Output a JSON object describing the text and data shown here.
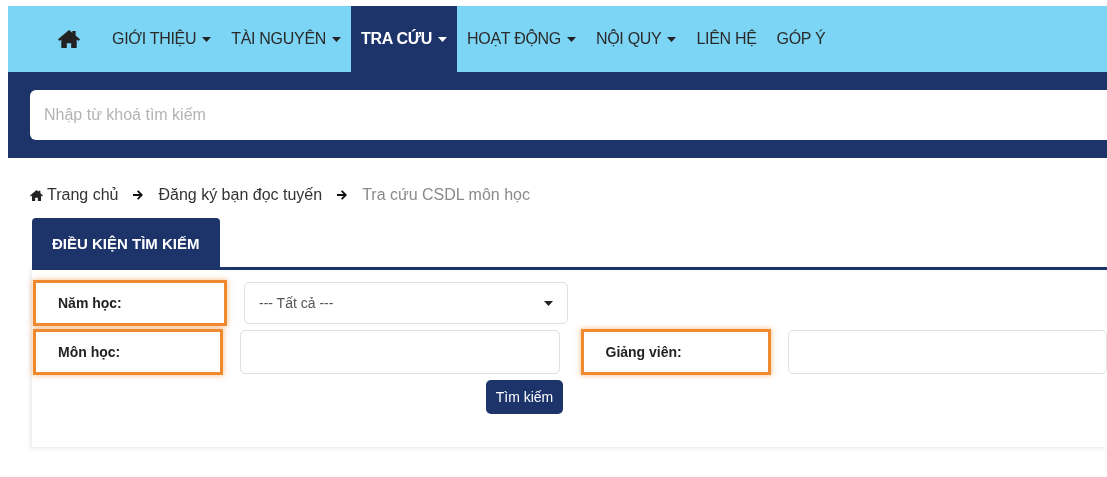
{
  "nav": {
    "items": [
      {
        "label": "GIỚI THIỆU",
        "dropdown": true,
        "selected": false
      },
      {
        "label": "TÀI NGUYÊN",
        "dropdown": true,
        "selected": false
      },
      {
        "label": "TRA CỨU",
        "dropdown": true,
        "selected": true
      },
      {
        "label": "HOẠT ĐỘNG",
        "dropdown": true,
        "selected": false
      },
      {
        "label": "NỘI QUY",
        "dropdown": true,
        "selected": false
      },
      {
        "label": "LIÊN HỆ",
        "dropdown": false,
        "selected": false
      },
      {
        "label": "GÓP Ý",
        "dropdown": false,
        "selected": false
      }
    ]
  },
  "search": {
    "placeholder": "Nhập từ khoá tìm kiếm"
  },
  "breadcrumb": [
    {
      "label": "Trang chủ",
      "kind": "home"
    },
    {
      "label": "Đăng ký bạn đọc tuyến",
      "kind": "link"
    },
    {
      "label": "Tra cứu CSDL môn học",
      "kind": "current"
    }
  ],
  "tab": {
    "label": "ĐIỀU KIỆN TÌM KIẾM"
  },
  "rows": [
    [
      {
        "label": "Năm học:",
        "highlighted": true,
        "kind": "select",
        "value": "--- Tất cả ---"
      }
    ],
    [
      {
        "label": "Môn học:",
        "highlighted": true,
        "kind": "text"
      },
      {
        "label": "Giảng viên:",
        "highlighted": true,
        "kind": "text"
      }
    ]
  ],
  "button": "Tìm kiếm"
}
